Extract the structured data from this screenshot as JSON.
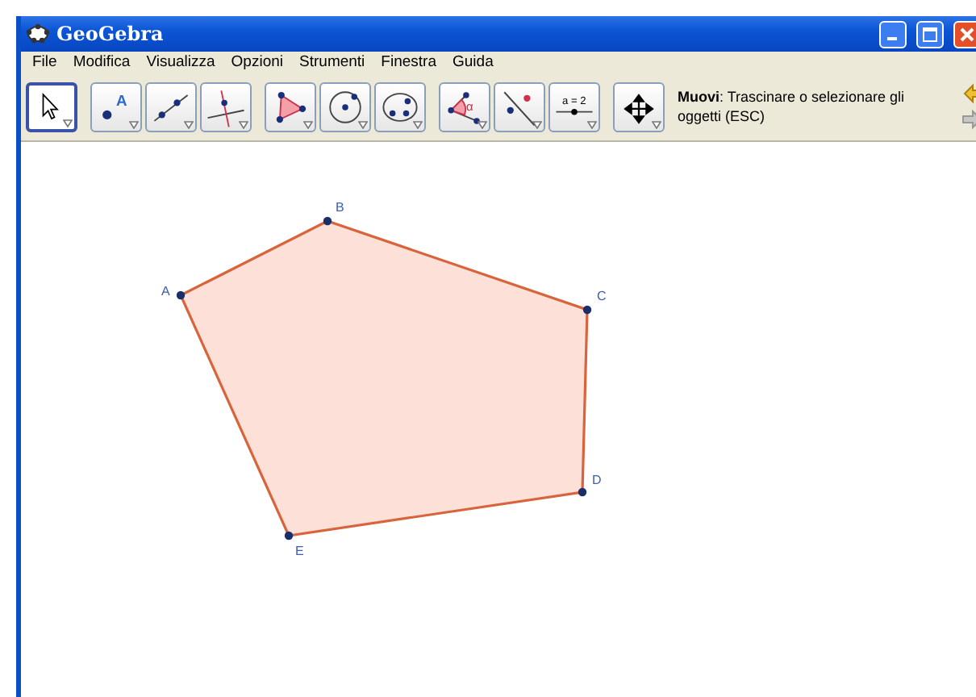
{
  "window": {
    "title": "GeoGebra"
  },
  "menu": [
    "File",
    "Modifica",
    "Visualizza",
    "Opzioni",
    "Strumenti",
    "Finestra",
    "Guida"
  ],
  "toolbar": {
    "groups": [
      [
        {
          "kind": "move",
          "selected": true
        }
      ],
      [
        {
          "kind": "point",
          "selected": false,
          "label": "A"
        },
        {
          "kind": "line",
          "selected": false
        },
        {
          "kind": "perpendicular",
          "selected": false
        }
      ],
      [
        {
          "kind": "polygon",
          "selected": false
        },
        {
          "kind": "circle",
          "selected": false
        },
        {
          "kind": "conic",
          "selected": false
        }
      ],
      [
        {
          "kind": "angle",
          "selected": false,
          "label": "α"
        },
        {
          "kind": "reflect",
          "selected": false
        },
        {
          "kind": "slider",
          "selected": false,
          "label": "a = 2"
        }
      ],
      [
        {
          "kind": "move-view",
          "selected": false
        }
      ]
    ],
    "help": "**Muovi**: Trascinare o selezionare gli oggetti (ESC)"
  },
  "canvas": {
    "points": [
      {
        "label": "A"
      },
      {
        "label": "B"
      },
      {
        "label": "C"
      },
      {
        "label": "D"
      },
      {
        "label": "E"
      }
    ]
  }
}
